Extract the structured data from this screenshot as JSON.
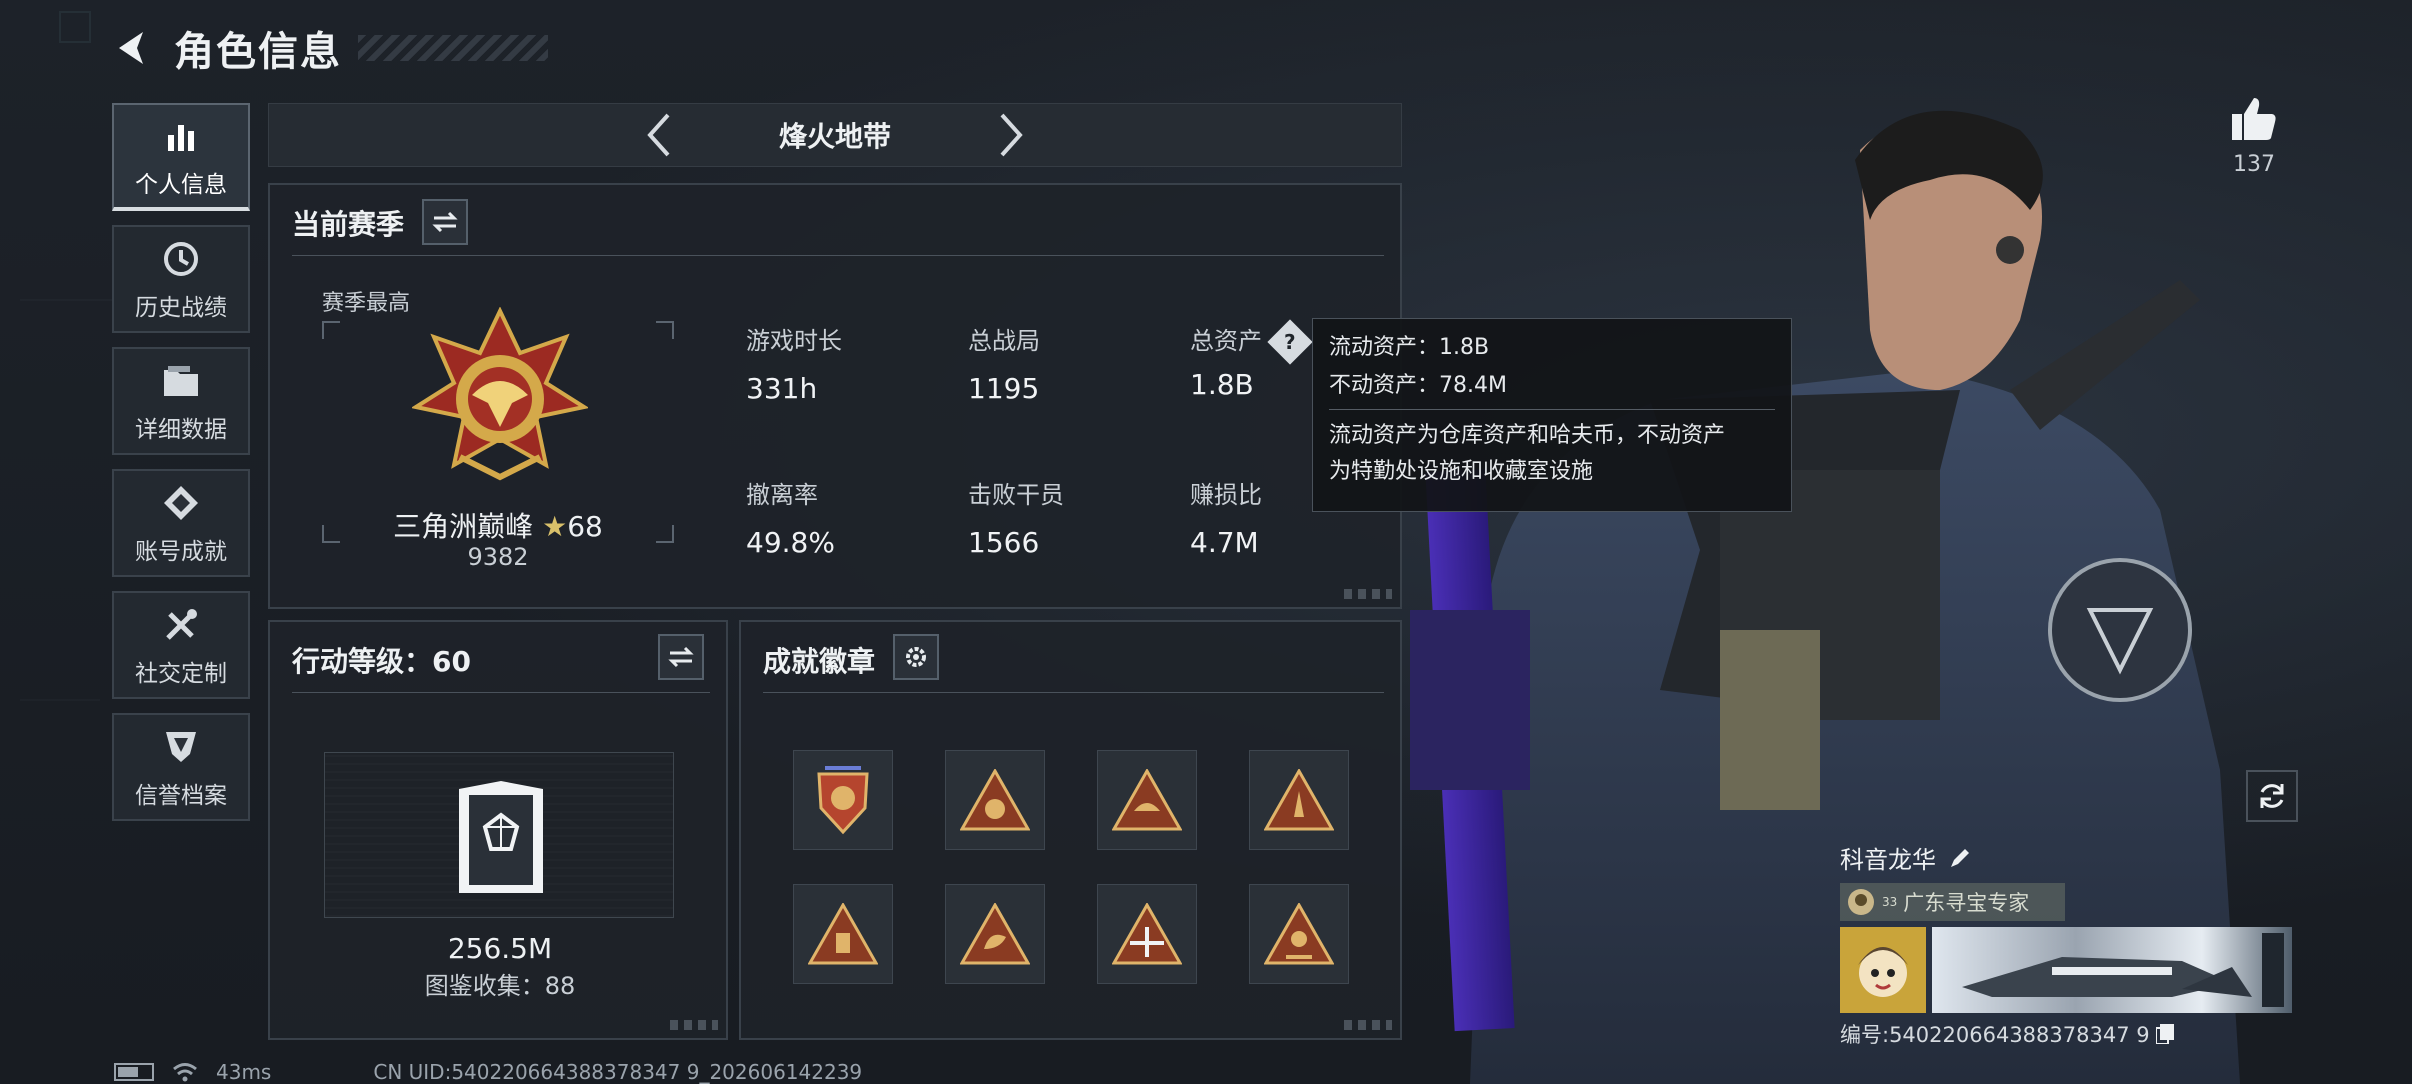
{
  "header": {
    "title": "角色信息"
  },
  "nav": {
    "items": [
      {
        "label": "个人信息",
        "icon": "bar-chart-icon",
        "active": true
      },
      {
        "label": "历史战绩",
        "icon": "history-clock-icon",
        "active": false
      },
      {
        "label": "详细数据",
        "icon": "folder-icon",
        "active": false
      },
      {
        "label": "账号成就",
        "icon": "achievement-icon",
        "active": false
      },
      {
        "label": "社交定制",
        "icon": "tools-icon",
        "active": false
      },
      {
        "label": "信誉档案",
        "icon": "shield-badge-icon",
        "active": false
      }
    ]
  },
  "mode": {
    "name": "烽火地带"
  },
  "season": {
    "title": "当前赛季",
    "best_label": "赛季最高",
    "rank_name": "三角洲巅峰",
    "rank_stars": "68",
    "rank_score": "9382",
    "stats": {
      "play_time": {
        "label": "游戏时长",
        "value": "331h"
      },
      "total_matches": {
        "label": "总战局",
        "value": "1195"
      },
      "total_assets": {
        "label": "总资产",
        "value": "1.8B"
      },
      "extract_rate": {
        "label": "撤离率",
        "value": "49.8%"
      },
      "operators_defeated": {
        "label": "击败干员",
        "value": "1566"
      },
      "profit_ratio": {
        "label": "赚损比",
        "value": "4.7M"
      }
    }
  },
  "tooltip": {
    "liquid": "流动资产：1.8B",
    "fixed": "不动资产：78.4M",
    "desc_1": "流动资产为仓库资产和哈夫币，不动资产",
    "desc_2": "为特勤处设施和收藏室设施"
  },
  "action_level": {
    "title": "行动等级：60",
    "value": "256.5M",
    "collection": "图鉴收集：88"
  },
  "badges": {
    "title": "成就徽章",
    "items": [
      "badge-1",
      "badge-2",
      "badge-3",
      "badge-4",
      "badge-5",
      "badge-6",
      "badge-7",
      "badge-8"
    ]
  },
  "like": {
    "count": "137"
  },
  "profile": {
    "name": "科音龙华",
    "title_level": "33",
    "title_tag": "广东寻宝专家",
    "uid": "编号:540220664388378347 9"
  },
  "status": {
    "ping": "43ms",
    "uid_footer": "CN UID:540220664388378347 9_202606142239"
  },
  "colors": {
    "accent": "#eef1f3",
    "panel": "#1e2329",
    "border": "#39414a",
    "gold": "#c9a43a"
  }
}
